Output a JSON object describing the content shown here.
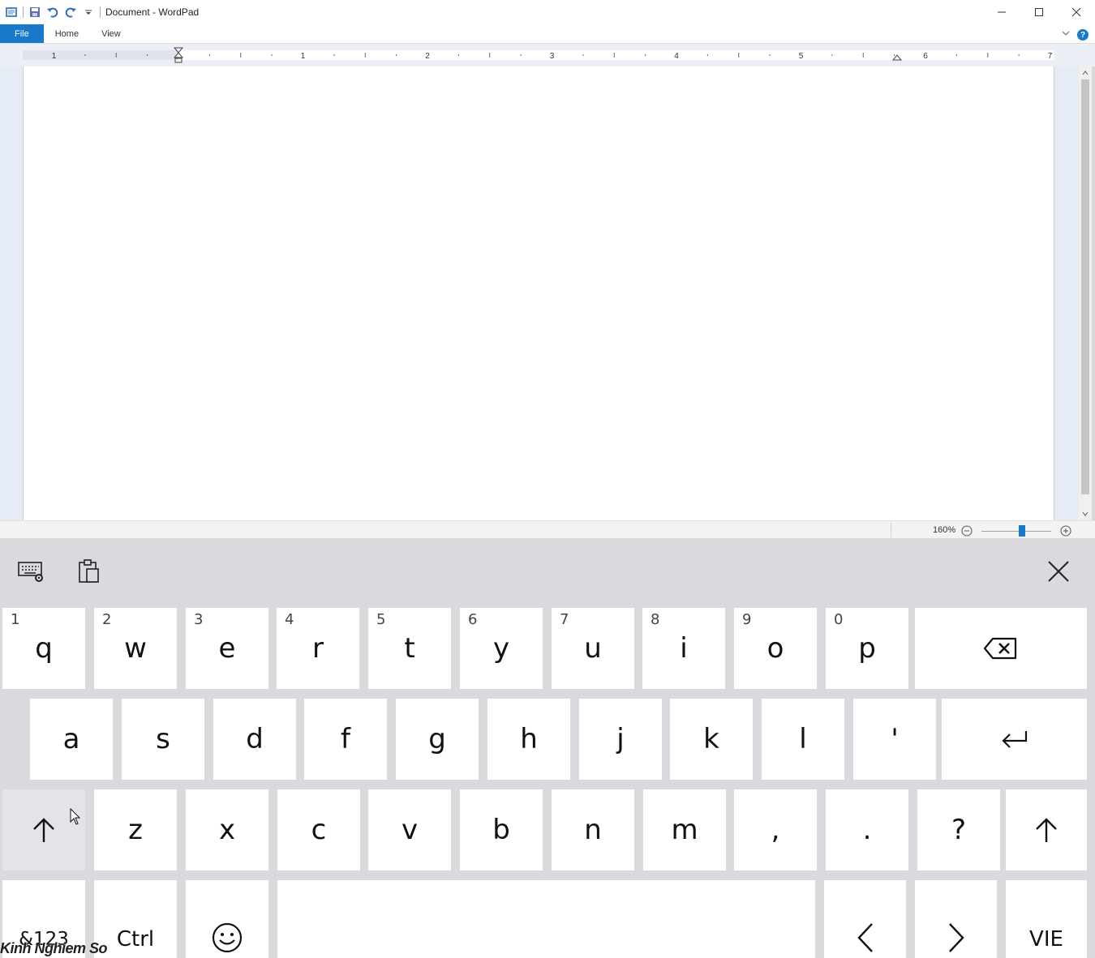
{
  "window": {
    "title": "Document - WordPad"
  },
  "ribbon": {
    "tabs": [
      "File",
      "Home",
      "View"
    ],
    "help_label": "?"
  },
  "ruler": {
    "labels": [
      "1",
      "1",
      "2",
      "3",
      "4",
      "5",
      "6",
      "7"
    ]
  },
  "statusbar": {
    "zoom": "160%",
    "zoom_percent": 160
  },
  "keyboard": {
    "row1": [
      {
        "num": "1",
        "key": "q"
      },
      {
        "num": "2",
        "key": "w"
      },
      {
        "num": "3",
        "key": "e"
      },
      {
        "num": "4",
        "key": "r"
      },
      {
        "num": "5",
        "key": "t"
      },
      {
        "num": "6",
        "key": "y"
      },
      {
        "num": "7",
        "key": "u"
      },
      {
        "num": "8",
        "key": "i"
      },
      {
        "num": "9",
        "key": "o"
      },
      {
        "num": "0",
        "key": "p"
      }
    ],
    "row2": [
      "a",
      "s",
      "d",
      "f",
      "g",
      "h",
      "j",
      "k",
      "l",
      "'"
    ],
    "row3": [
      "z",
      "x",
      "c",
      "v",
      "b",
      "n",
      "m",
      ",",
      ".",
      "?"
    ],
    "symbols_label": "&123",
    "ctrl_label": "Ctrl",
    "language_label": "VIE"
  },
  "watermark": {
    "text": "Kinh Nghiem So"
  },
  "icons": {
    "backspace": "backspace-icon",
    "enter": "enter-icon",
    "shift": "shift-icon",
    "emoji": "emoji-icon",
    "left": "arrow-left-icon",
    "right": "arrow-right-icon",
    "keyboard_settings": "keyboard-settings-icon",
    "clipboard": "clipboard-icon",
    "close": "close-icon"
  },
  "colors": {
    "accent": "#1979ca",
    "keyboard_bg": "#d9d9de",
    "key_bg": "#ffffff"
  }
}
